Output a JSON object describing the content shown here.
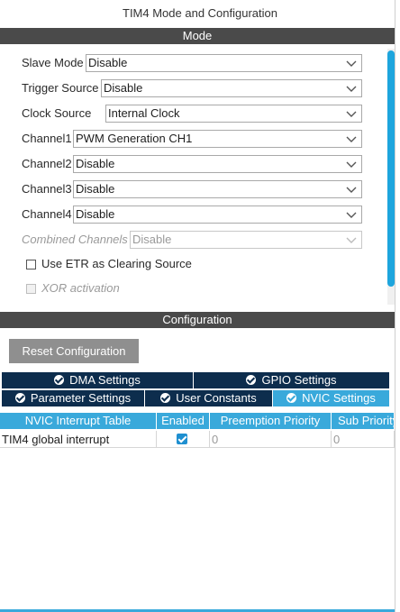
{
  "window": {
    "title": "TIM4 Mode and Configuration"
  },
  "mode": {
    "header": "Mode",
    "fields": [
      {
        "label": "Slave Mode",
        "value": "Disable"
      },
      {
        "label": "Trigger Source",
        "value": "Disable"
      },
      {
        "label": "Clock Source",
        "value": "Internal Clock"
      },
      {
        "label": "Channel1",
        "value": "PWM Generation CH1"
      },
      {
        "label": "Channel2",
        "value": "Disable"
      },
      {
        "label": "Channel3",
        "value": "Disable"
      },
      {
        "label": "Channel4",
        "value": "Disable"
      },
      {
        "label": "Combined Channels",
        "value": "Disable"
      }
    ],
    "checkboxes": [
      {
        "label": "Use ETR as Clearing Source",
        "checked": false
      },
      {
        "label": "XOR activation",
        "checked": false
      }
    ]
  },
  "configuration": {
    "header": "Configuration",
    "reset_label": "Reset Configuration",
    "tabs_row1": [
      {
        "label": "DMA Settings"
      },
      {
        "label": "GPIO Settings"
      }
    ],
    "tabs_row2": [
      {
        "label": "Parameter Settings"
      },
      {
        "label": "User Constants"
      },
      {
        "label": "NVIC Settings",
        "active": true
      }
    ],
    "table": {
      "columns": [
        "NVIC Interrupt Table",
        "Enabled",
        "Preemption Priority",
        "Sub Priority"
      ],
      "rows": [
        {
          "name": "TIM4 global interrupt",
          "enabled": true,
          "preemption": "0",
          "sub": "0"
        }
      ]
    }
  },
  "colors": {
    "section_bar": "#4a4a4a",
    "tab_dark": "#0d2d4d",
    "tab_active": "#39a9db",
    "accent": "#1ea5dd"
  }
}
